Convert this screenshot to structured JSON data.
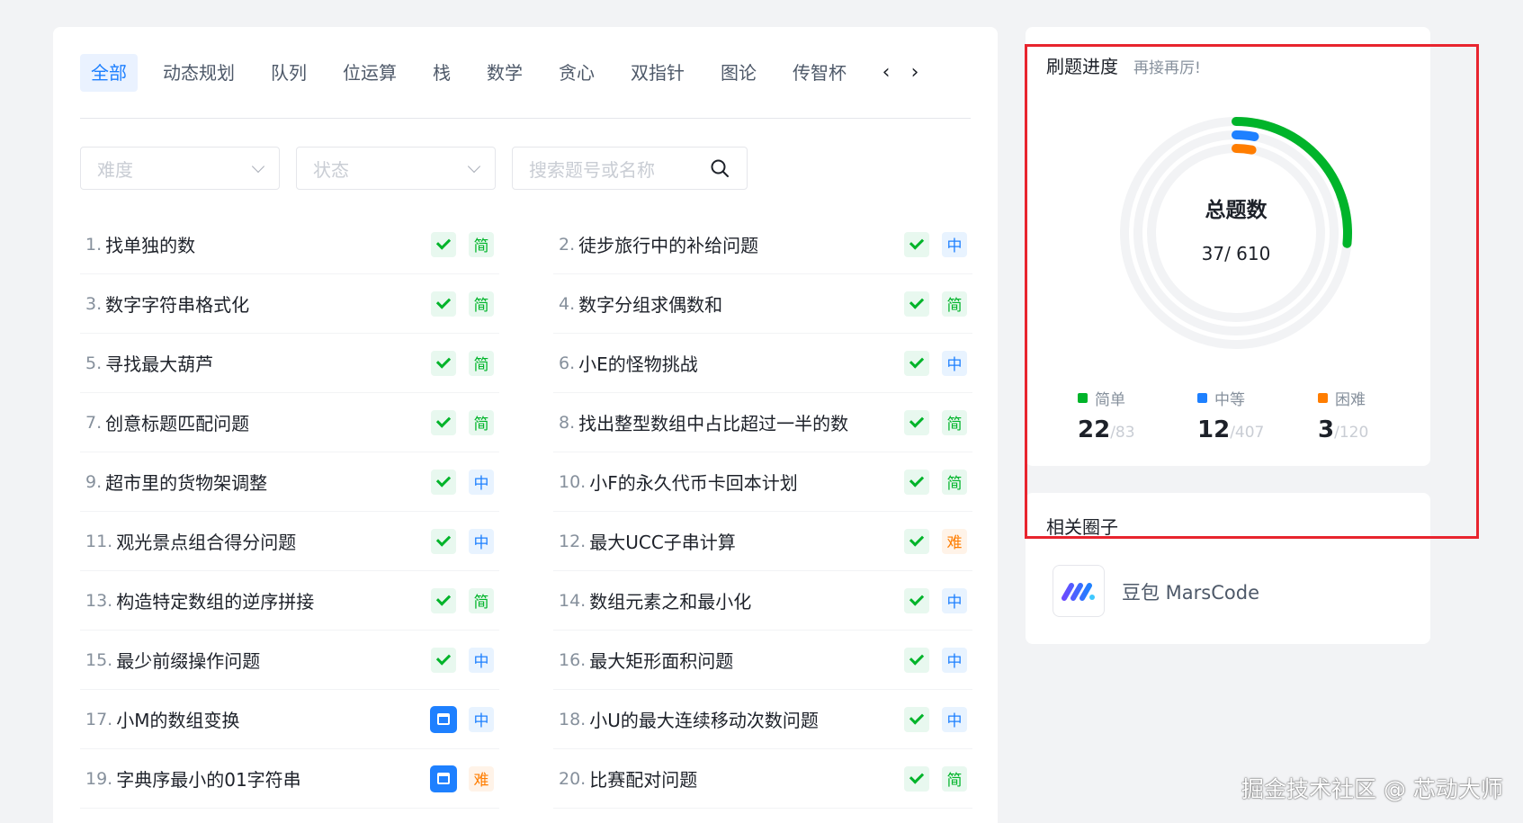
{
  "tabs": [
    "全部",
    "动态规划",
    "队列",
    "位运算",
    "栈",
    "数学",
    "贪心",
    "双指针",
    "图论",
    "传智杯"
  ],
  "nav": {
    "prev": "‹",
    "next": "›"
  },
  "filters": {
    "difficulty_placeholder": "难度",
    "status_placeholder": "状态",
    "search_placeholder": "搜索题号或名称"
  },
  "problems": [
    {
      "num": "1.",
      "title": "找单独的数",
      "status": "done",
      "difficulty": "简",
      "level": "easy"
    },
    {
      "num": "2.",
      "title": "徒步旅行中的补给问题",
      "status": "done",
      "difficulty": "中",
      "level": "mid"
    },
    {
      "num": "3.",
      "title": "数字字符串格式化",
      "status": "done",
      "difficulty": "简",
      "level": "easy"
    },
    {
      "num": "4.",
      "title": "数字分组求偶数和",
      "status": "done",
      "difficulty": "简",
      "level": "easy"
    },
    {
      "num": "5.",
      "title": "寻找最大葫芦",
      "status": "done",
      "difficulty": "简",
      "level": "easy"
    },
    {
      "num": "6.",
      "title": "小E的怪物挑战",
      "status": "done",
      "difficulty": "中",
      "level": "mid"
    },
    {
      "num": "7.",
      "title": "创意标题匹配问题",
      "status": "done",
      "difficulty": "简",
      "level": "easy"
    },
    {
      "num": "8.",
      "title": "找出整型数组中占比超过一半的数",
      "status": "done",
      "difficulty": "简",
      "level": "easy"
    },
    {
      "num": "9.",
      "title": "超市里的货物架调整",
      "status": "done",
      "difficulty": "中",
      "level": "mid"
    },
    {
      "num": "10.",
      "title": "小F的永久代币卡回本计划",
      "status": "done",
      "difficulty": "简",
      "level": "easy"
    },
    {
      "num": "11.",
      "title": "观光景点组合得分问题",
      "status": "done",
      "difficulty": "中",
      "level": "mid"
    },
    {
      "num": "12.",
      "title": "最大UCC子串计算",
      "status": "done",
      "difficulty": "难",
      "level": "hard"
    },
    {
      "num": "13.",
      "title": "构造特定数组的逆序拼接",
      "status": "done",
      "difficulty": "简",
      "level": "easy"
    },
    {
      "num": "14.",
      "title": "数组元素之和最小化",
      "status": "done",
      "difficulty": "中",
      "level": "mid"
    },
    {
      "num": "15.",
      "title": "最少前缀操作问题",
      "status": "done",
      "difficulty": "中",
      "level": "mid"
    },
    {
      "num": "16.",
      "title": "最大矩形面积问题",
      "status": "done",
      "difficulty": "中",
      "level": "mid"
    },
    {
      "num": "17.",
      "title": "小M的数组变换",
      "status": "calendar",
      "difficulty": "中",
      "level": "mid"
    },
    {
      "num": "18.",
      "title": "小U的最大连续移动次数问题",
      "status": "done",
      "difficulty": "中",
      "level": "mid"
    },
    {
      "num": "19.",
      "title": "字典序最小的01字符串",
      "status": "calendar",
      "difficulty": "难",
      "level": "hard"
    },
    {
      "num": "20.",
      "title": "比赛配对问题",
      "status": "done",
      "difficulty": "简",
      "level": "easy"
    }
  ],
  "progress": {
    "title": "刷题进度",
    "subtitle": "再接再厉!",
    "ring_label": "总题数",
    "ring_count": "37/ 610",
    "solved": 37,
    "total": 610,
    "stats": [
      {
        "label": "简单",
        "solved": "22",
        "total": "/83",
        "color": "#00b42a",
        "solved_n": 22,
        "total_n": 83
      },
      {
        "label": "中等",
        "solved": "12",
        "total": "/407",
        "color": "#1e80ff",
        "solved_n": 12,
        "total_n": 407
      },
      {
        "label": "困难",
        "solved": "3",
        "total": "/120",
        "color": "#ff7d00",
        "solved_n": 3,
        "total_n": 120
      }
    ]
  },
  "circles": {
    "title": "相关圈子",
    "name": "豆包 MarsCode"
  },
  "watermark": "掘金技术社区 @ 芯动大师",
  "colors": {
    "accent": "#1e80ff",
    "easy": "#00b42a",
    "mid": "#1e80ff",
    "hard": "#ff7d00",
    "highlight": "#e8242e"
  }
}
